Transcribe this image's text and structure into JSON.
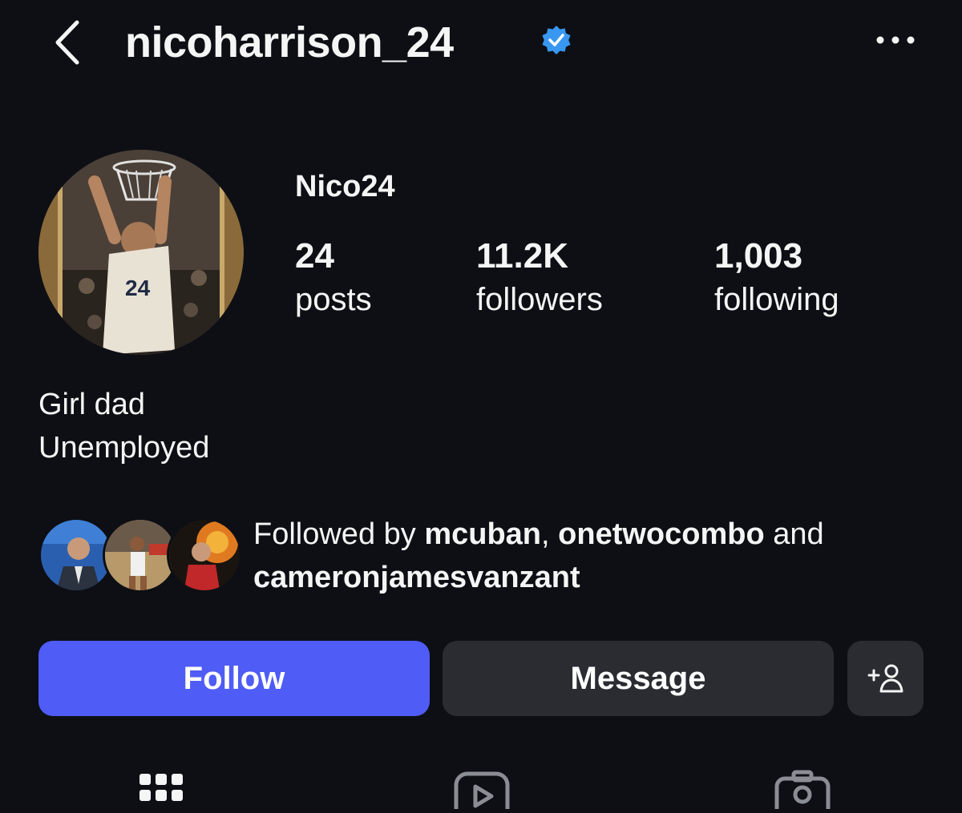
{
  "header": {
    "username": "nicoharrison_24",
    "verified": true,
    "icons": {
      "back": "chevron-left-icon",
      "more": "more-horizontal-icon",
      "verified": "verified-badge-icon"
    }
  },
  "profile": {
    "display_name": "Nico24",
    "avatar_description": "basketball player dunking, jersey 24 Montana State",
    "avatar_jersey_number": "24"
  },
  "stats": [
    {
      "value": "24",
      "label": "posts"
    },
    {
      "value": "11.2K",
      "label": "followers"
    },
    {
      "value": "1,003",
      "label": "following"
    }
  ],
  "bio": [
    "Girl dad",
    "Unemployed"
  ],
  "followed_by": {
    "prefix": "Followed by ",
    "users": [
      "mcuban",
      "onetwocombo",
      "cameronjamesvanzant"
    ],
    "separator": ", ",
    "conjunction": " and "
  },
  "actions": {
    "follow_label": "Follow",
    "message_label": "Message",
    "suggest_icon": "add-person-icon"
  },
  "tabs": [
    {
      "name": "grid-icon"
    },
    {
      "name": "reels-icon"
    },
    {
      "name": "tagged-icon"
    }
  ],
  "colors": {
    "background": "#0d0f14",
    "follow_button": "#4f5cf5",
    "secondary_button": "#2a2c32",
    "verified": "#3897f0"
  }
}
